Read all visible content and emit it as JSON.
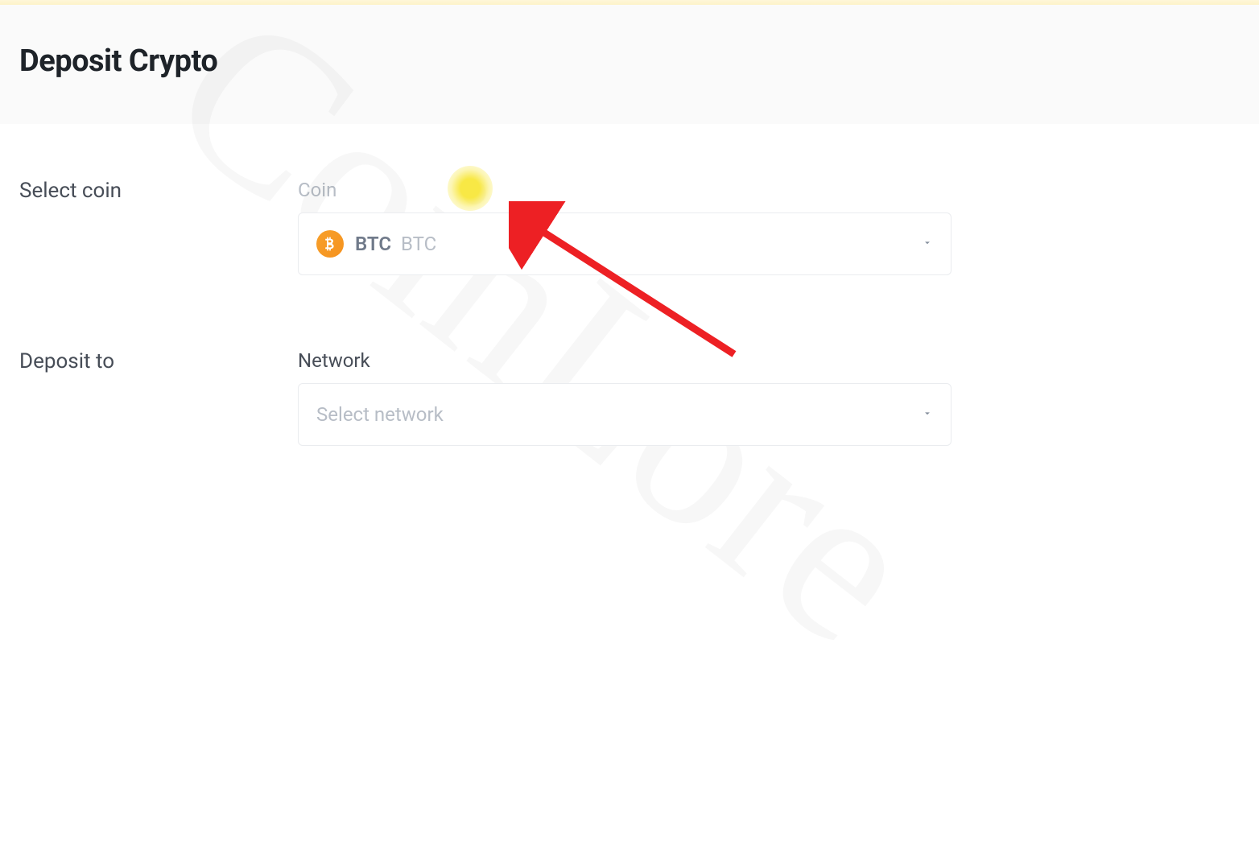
{
  "header": {
    "title": "Deposit Crypto"
  },
  "form": {
    "selectCoin": {
      "rowLabel": "Select coin",
      "fieldLabel": "Coin",
      "selected": {
        "symbol": "BTC",
        "name": "BTC",
        "iconColor": "#f7931a"
      }
    },
    "depositTo": {
      "rowLabel": "Deposit to",
      "fieldLabel": "Network",
      "placeholder": "Select network"
    }
  },
  "watermarkText": "CoinLore"
}
